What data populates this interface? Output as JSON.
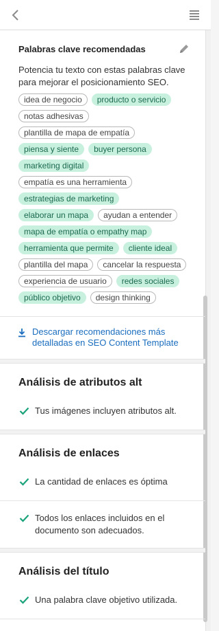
{
  "topbar": {
    "back_icon": "chevron-left-icon",
    "menu_icon": "hamburger-menu-icon"
  },
  "keywords": {
    "title": "Palabras clave recomendadas",
    "edit_icon": "pencil-icon",
    "description": "Potencia tu texto con estas palabras clave para mejorar el posicionamiento SEO.",
    "tags": [
      {
        "label": "idea de negocio",
        "used": false
      },
      {
        "label": "producto o servicio",
        "used": true
      },
      {
        "label": "notas adhesivas",
        "used": false
      },
      {
        "label": "plantilla de mapa de empatía",
        "used": false
      },
      {
        "label": "piensa y siente",
        "used": true
      },
      {
        "label": "buyer persona",
        "used": true
      },
      {
        "label": "marketing digital",
        "used": true
      },
      {
        "label": "empatía es una herramienta",
        "used": false
      },
      {
        "label": "estrategias de marketing",
        "used": true
      },
      {
        "label": "elaborar un mapa",
        "used": true
      },
      {
        "label": "ayudan a entender",
        "used": false
      },
      {
        "label": "mapa de empatía o empathy map",
        "used": true
      },
      {
        "label": "herramienta que permite",
        "used": true
      },
      {
        "label": "cliente ideal",
        "used": true
      },
      {
        "label": "plantilla del mapa",
        "used": false
      },
      {
        "label": "cancelar la respuesta",
        "used": false
      },
      {
        "label": "experiencia de usuario",
        "used": false
      },
      {
        "label": "redes sociales",
        "used": true
      },
      {
        "label": "público objetivo",
        "used": true
      },
      {
        "label": "design thinking",
        "used": false
      }
    ],
    "download_icon": "download-icon",
    "download_link": "Descargar recomendaciones más detalladas en SEO Content Template"
  },
  "alt_analysis": {
    "title": "Análisis de atributos alt",
    "items": [
      "Tus imágenes incluyen atributos alt."
    ]
  },
  "links_analysis": {
    "title": "Análisis de enlaces",
    "items": [
      "La cantidad de enlaces es óptima",
      "Todos los enlaces incluidos en el documento son adecuados."
    ]
  },
  "title_analysis": {
    "title": "Análisis del título",
    "items": [
      "Una palabra clave objetivo utilizada."
    ]
  },
  "colors": {
    "accent_green": "#1aa37a",
    "tag_highlight": "#c7f0df",
    "link_blue": "#1a6dbf"
  }
}
